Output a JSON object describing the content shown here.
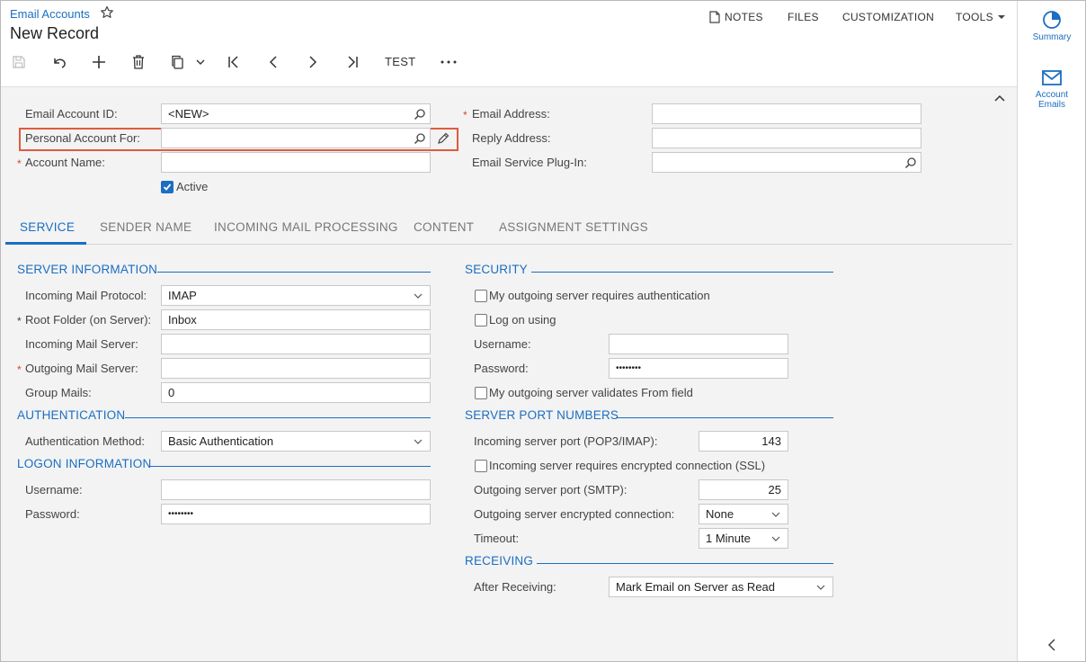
{
  "header": {
    "breadcrumb": "Email Accounts",
    "title": "New Record",
    "menu": {
      "notes": "NOTES",
      "files": "FILES",
      "customization": "CUSTOMIZATION",
      "tools": "TOOLS"
    },
    "toolbar": {
      "test": "TEST"
    }
  },
  "form": {
    "email_account_id": {
      "label": "Email Account ID:",
      "value": "<NEW>"
    },
    "personal_account_for": {
      "label": "Personal Account For:",
      "value": ""
    },
    "account_name": {
      "label": "Account Name:",
      "value": ""
    },
    "active": {
      "label": "Active",
      "checked": true
    },
    "email_address": {
      "label": "Email Address:",
      "value": ""
    },
    "reply_address": {
      "label": "Reply Address:",
      "value": ""
    },
    "email_service_plugin": {
      "label": "Email Service Plug-In:",
      "value": ""
    },
    "required_mark": "*"
  },
  "tabs": [
    "SERVICE",
    "SENDER NAME",
    "INCOMING MAIL PROCESSING",
    "CONTENT",
    "ASSIGNMENT SETTINGS"
  ],
  "service": {
    "server_information": {
      "title": "SERVER INFORMATION",
      "incoming_mail_protocol": {
        "label": "Incoming Mail Protocol:",
        "value": "IMAP"
      },
      "root_folder": {
        "label": "Root Folder (on Server):",
        "value": "Inbox"
      },
      "incoming_mail_server": {
        "label": "Incoming Mail Server:",
        "value": ""
      },
      "outgoing_mail_server": {
        "label": "Outgoing Mail Server:",
        "value": ""
      },
      "group_mails": {
        "label": "Group Mails:",
        "value": "0"
      }
    },
    "authentication": {
      "title": "AUTHENTICATION",
      "method": {
        "label": "Authentication Method:",
        "value": "Basic Authentication"
      }
    },
    "logon_information": {
      "title": "LOGON INFORMATION",
      "username": {
        "label": "Username:",
        "value": ""
      },
      "password": {
        "label": "Password:",
        "value": "••••••••"
      }
    },
    "security": {
      "title": "SECURITY",
      "outgoing_requires_auth": {
        "label": "My outgoing server requires authentication",
        "checked": false
      },
      "log_on_using": {
        "label": "Log on using",
        "checked": false
      },
      "username": {
        "label": "Username:",
        "value": ""
      },
      "password": {
        "label": "Password:",
        "value": "••••••••"
      },
      "validates_from": {
        "label": "My outgoing server validates From field",
        "checked": false
      }
    },
    "server_port_numbers": {
      "title": "SERVER PORT NUMBERS",
      "incoming_port": {
        "label": "Incoming server port (POP3/IMAP):",
        "value": "143"
      },
      "incoming_ssl": {
        "label": "Incoming server requires encrypted connection (SSL)",
        "checked": false
      },
      "outgoing_port": {
        "label": "Outgoing server port (SMTP):",
        "value": "25"
      },
      "outgoing_encrypted": {
        "label": "Outgoing server encrypted connection:",
        "value": "None"
      },
      "timeout": {
        "label": "Timeout:",
        "value": "1 Minute"
      }
    },
    "receiving": {
      "title": "RECEIVING",
      "after_receiving": {
        "label": "After Receiving:",
        "value": "Mark Email on Server as Read"
      }
    }
  },
  "side_panel": {
    "summary": "Summary",
    "account_emails_line1": "Account",
    "account_emails_line2": "Emails"
  },
  "colors": {
    "accent": "#1b6ec2",
    "required": "#d9442b",
    "highlight": "#e05a3e"
  }
}
